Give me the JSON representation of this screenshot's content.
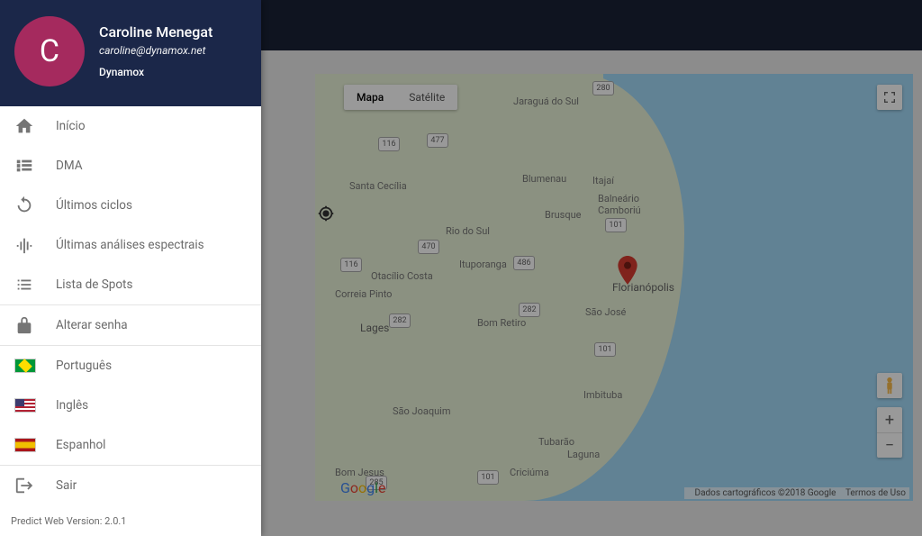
{
  "profile": {
    "initial": "C",
    "name": "Caroline Menegat",
    "email": "caroline@dynamox.net",
    "company": "Dynamox"
  },
  "menu": {
    "home": "Início",
    "dma": "DMA",
    "ciclos": "Últimos ciclos",
    "espectrais": "Últimas análises espectrais",
    "spots": "Lista de Spots",
    "senha": "Alterar senha",
    "pt": "Português",
    "en": "Inglês",
    "es": "Espanhol",
    "sair": "Sair"
  },
  "footer": "Predict Web Version: 2.0.1",
  "map": {
    "type_map": "Mapa",
    "type_sat": "Satélite",
    "attribution": "Dados cartográficos ©2018 Google",
    "terms": "Termos de Uso",
    "cities": {
      "jaragua": "Jaraguá do Sul",
      "blumenau": "Blumenau",
      "itajai": "Itajaí",
      "balneario": "Balneário\nCamboriú",
      "brusque": "Brusque",
      "riodosul": "Rio do Sul",
      "ituporanga": "Ituporanga",
      "florianopolis": "Florianópolis",
      "saojose": "São José",
      "lages": "Lages",
      "bomretiro": "Bom Retiro",
      "saojoaquim": "São Joaquim",
      "imbituba": "Imbituba",
      "tubarao": "Tubarão",
      "laguna": "Laguna",
      "criciuma": "Criciúma",
      "otacilio": "Otacílio Costa",
      "correia": "Correia Pinto",
      "santacecilia": "Santa Cecília",
      "bjesus": "Bom Jesus"
    },
    "roads": {
      "r280": "280",
      "r116a": "116",
      "r477": "477",
      "r470": "470",
      "r116b": "116",
      "r486": "486",
      "r282a": "282",
      "r282b": "282",
      "r285": "285",
      "r101a": "101",
      "r101b": "101",
      "r101c": "101"
    }
  }
}
